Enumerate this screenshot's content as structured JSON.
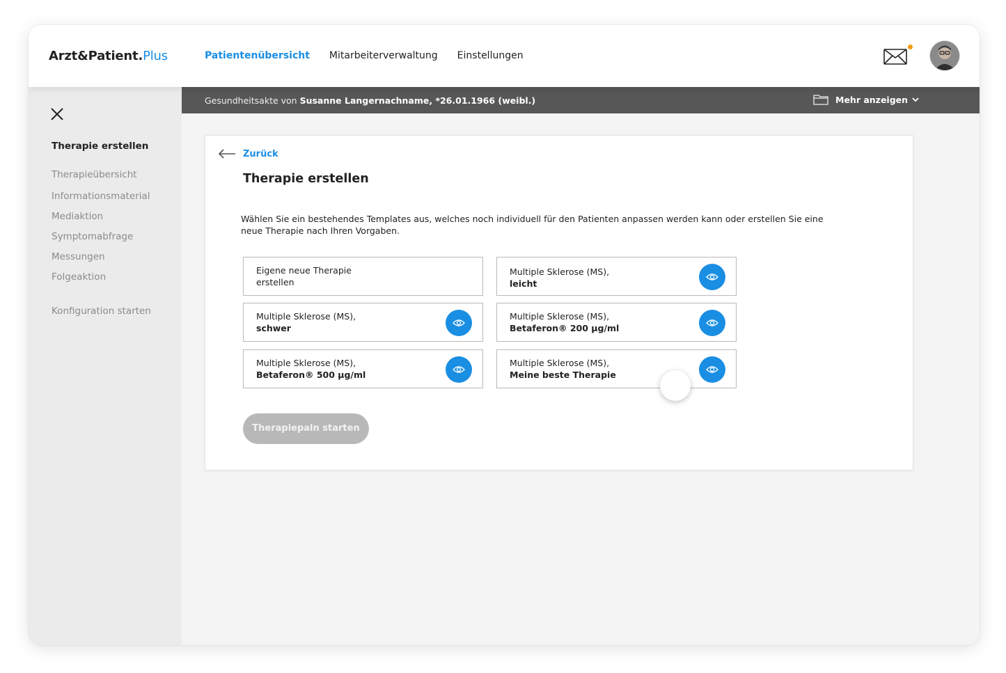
{
  "app": {
    "logo_main": "Arzt&Patient.",
    "logo_plus": "Plus"
  },
  "nav": [
    {
      "label": "Patientenübersicht",
      "active": true
    },
    {
      "label": "Mitarbeiterverwaltung",
      "active": false
    },
    {
      "label": "Einstellungen",
      "active": false
    }
  ],
  "header": {
    "mail_icon": "mail-icon",
    "notification_color": "#f39c12"
  },
  "patient_bar": {
    "prefix": "Gesundheitsakte von ",
    "patient": "Susanne Langernachname, *26.01.1966 (weibl.)",
    "more_label": "Mehr anzeigen"
  },
  "sidebar": {
    "title": "Therapie erstellen",
    "items": [
      "Therapieübersicht",
      "Informationsmaterial",
      "Mediaktion",
      "Symptomabfrage",
      "Messungen",
      "Folgeaktion",
      "Konfiguration starten"
    ]
  },
  "main": {
    "back_label": "Zurück",
    "title": "Therapie erstellen",
    "description": "Wählen Sie ein bestehendes Templates aus, welches noch individuell für den Patienten anpassen werden kann oder erstellen Sie eine neue Therapie nach Ihren Vorgaben.",
    "options": [
      {
        "line1": "Eigene neue Therapie",
        "line2": "erstellen",
        "bold": false
      },
      {
        "line1": "Multiple Sklerose (MS),",
        "line2": "leicht",
        "bold": true
      },
      {
        "line1": "Multiple Sklerose (MS),",
        "line2": "schwer",
        "bold": true
      },
      {
        "line1": "Multiple Sklerose (MS),",
        "line2": "Betaferon® 200 µg/ml",
        "bold": true
      },
      {
        "line1": "Multiple Sklerose (MS),",
        "line2": "Betaferon® 500 µg/ml",
        "bold": true
      },
      {
        "line1": "Multiple Sklerose (MS),",
        "line2": "Meine beste Therapie",
        "bold": true
      }
    ],
    "start_button": "Therapiepaln starten"
  },
  "colors": {
    "accent": "#1a8ee3",
    "patient_bar": "#575757",
    "disabled_button": "#b8b8b8"
  }
}
